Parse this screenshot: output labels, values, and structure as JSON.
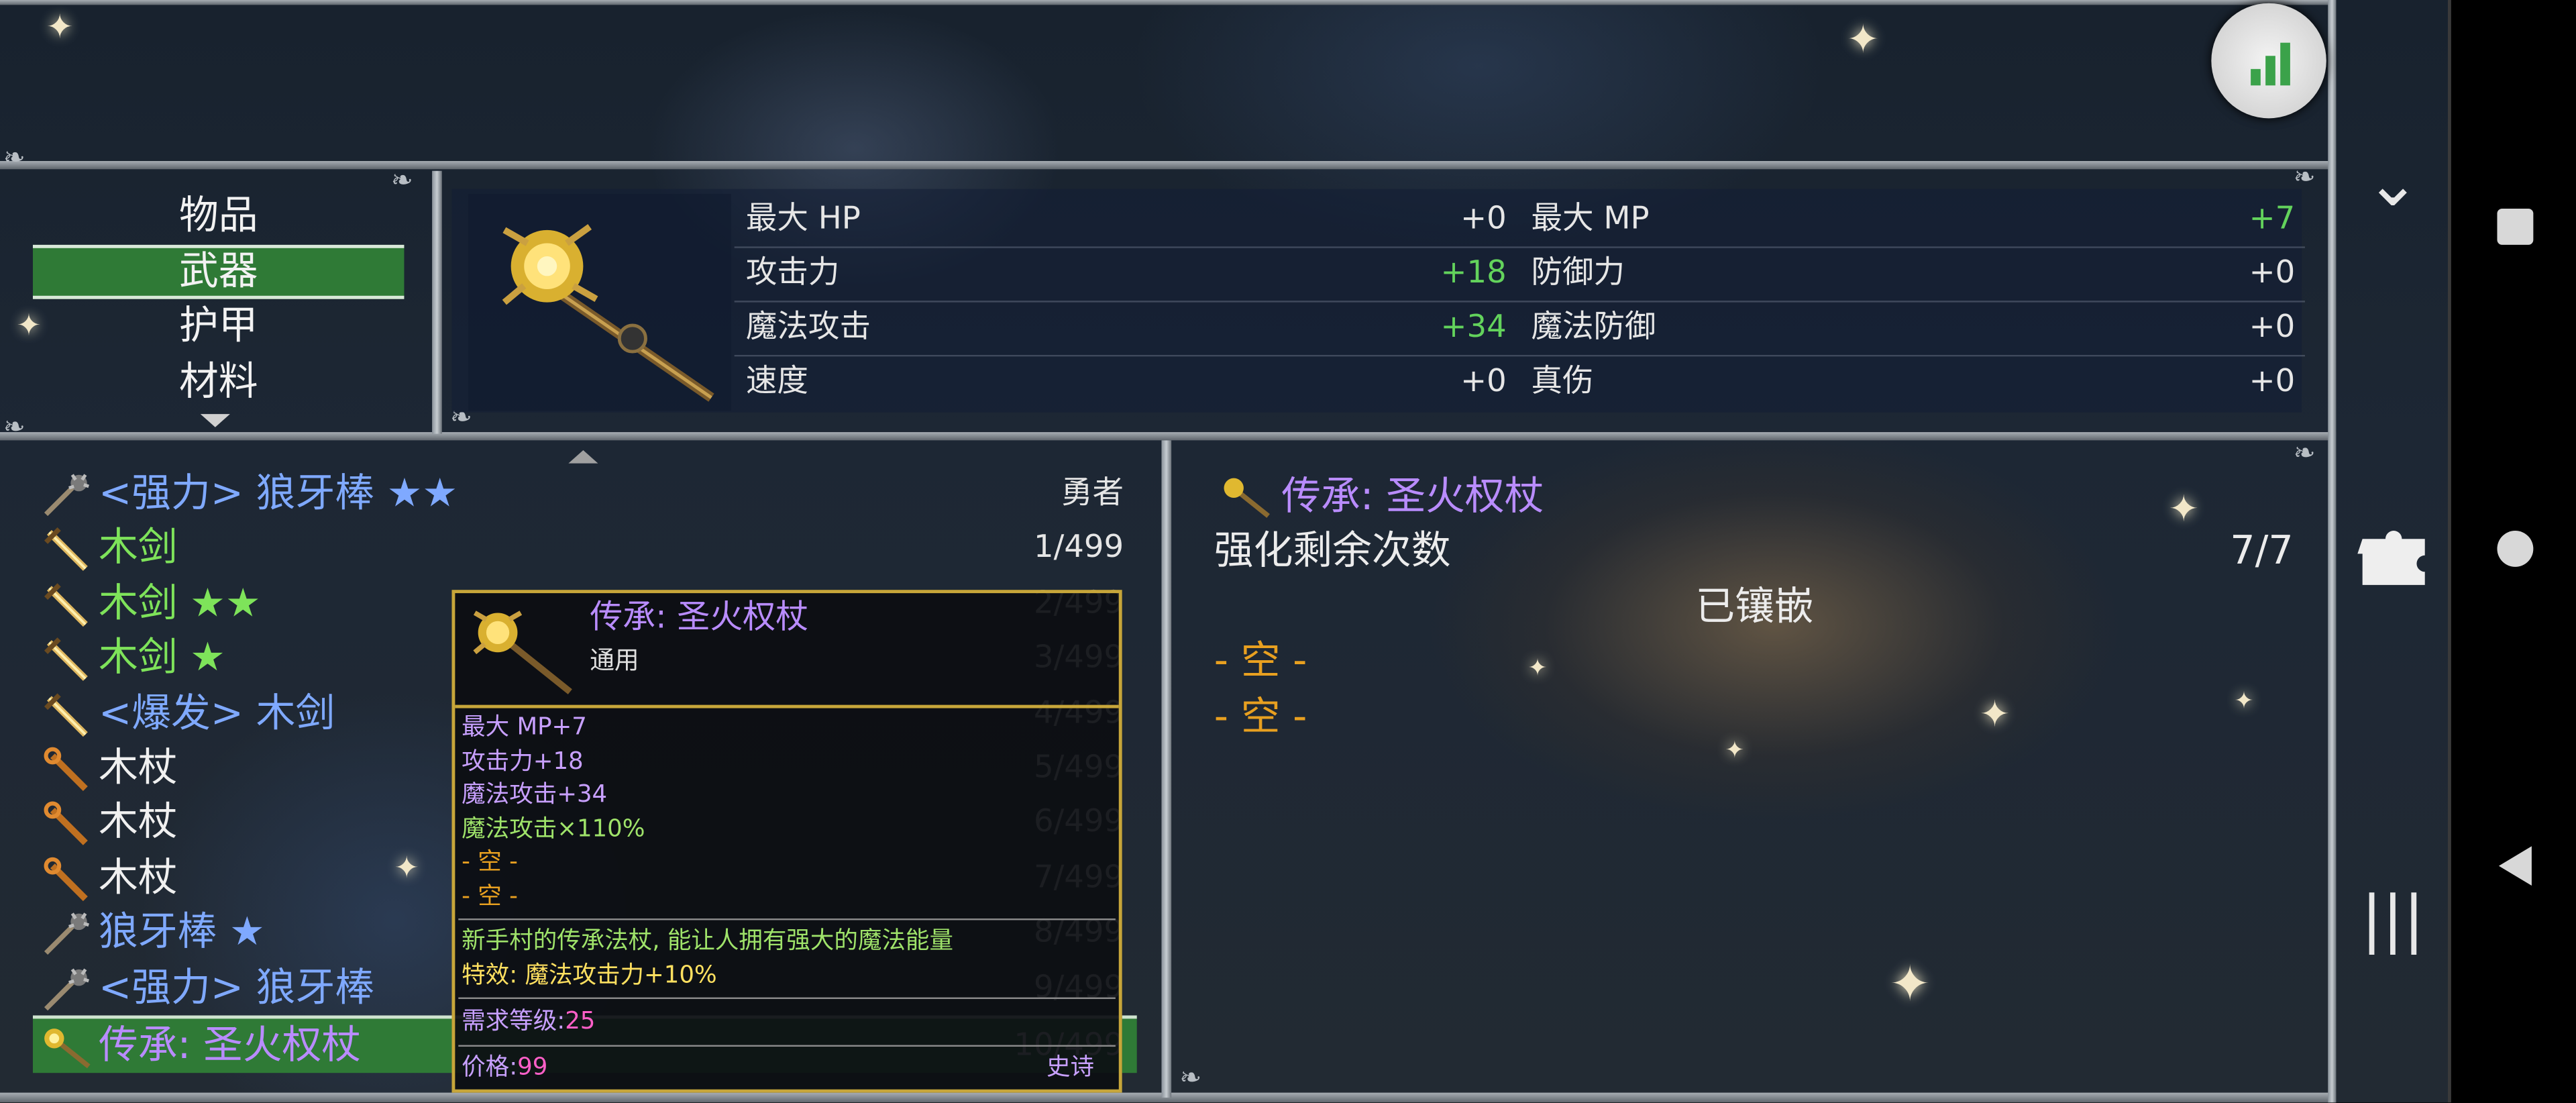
{
  "categories": {
    "items": [
      "物品",
      "武器",
      "护甲",
      "材料"
    ],
    "selected": "武器"
  },
  "stats": {
    "rows": [
      {
        "l_label": "最大 HP",
        "l_value": "+0",
        "r_label": "最大 MP",
        "r_value": "+7"
      },
      {
        "l_label": "攻击力",
        "l_value": "+18",
        "r_label": "防御力",
        "r_value": "+0"
      },
      {
        "l_label": "魔法攻击",
        "l_value": "+34",
        "r_label": "魔法防御",
        "r_value": "+0"
      },
      {
        "l_label": "速度",
        "l_value": "+0",
        "r_label": "真伤",
        "r_value": "+0"
      }
    ]
  },
  "item_list": [
    {
      "name": "<强力> 狼牙棒 ★★",
      "count": "勇者",
      "color": "blue",
      "icon": "mace-icon"
    },
    {
      "name": "木剑",
      "count": "1/499",
      "color": "green",
      "icon": "sword-icon"
    },
    {
      "name": "木剑 ★★",
      "count": "2/499",
      "color": "green",
      "icon": "sword-icon"
    },
    {
      "name": "木剑 ★",
      "count": "3/499",
      "color": "green",
      "icon": "sword-icon"
    },
    {
      "name": "<爆发> 木剑",
      "count": "4/499",
      "color": "blue",
      "icon": "sword-icon"
    },
    {
      "name": "木杖",
      "count": "5/499",
      "color": "white",
      "icon": "staff-icon"
    },
    {
      "name": "木杖",
      "count": "6/499",
      "color": "white",
      "icon": "staff-icon"
    },
    {
      "name": "木杖",
      "count": "7/499",
      "color": "white",
      "icon": "staff-icon"
    },
    {
      "name": "狼牙棒 ★",
      "count": "8/499",
      "color": "blue",
      "icon": "mace-icon"
    },
    {
      "name": "<强力> 狼牙棒",
      "count": "9/499",
      "color": "blue",
      "icon": "mace-icon"
    },
    {
      "name": "传承: 圣火权杖",
      "count": "10/499",
      "color": "purple",
      "icon": "scepter-icon"
    }
  ],
  "tooltip": {
    "title": "传承: 圣火权杖",
    "subtitle": "通用",
    "attrs": [
      "最大 MP+7",
      "攻击力+18",
      "魔法攻击+34",
      "魔法攻击×110%"
    ],
    "slots": [
      "- 空 -",
      "- 空 -"
    ],
    "description": "新手村的传承法杖, 能让人拥有强大的魔法能量",
    "effect": "特效: 魔法攻击力+10%",
    "req_label": "需求等级:",
    "req_value": "25",
    "price_label": "价格:",
    "price_value": "99",
    "rarity": "史诗"
  },
  "detail": {
    "title": "传承: 圣火权杖",
    "refine_label": "强化剩余次数",
    "refine_value": "7/7",
    "inlaid_label": "已镶嵌",
    "slots": [
      "- 空 -",
      "- 空 -"
    ]
  },
  "colors": {
    "selection_green": "#2f7a36",
    "stat_green": "#63d35c",
    "legendary_purple": "#b98cff",
    "rare_blue": "#7fa9ff",
    "uncommon_green": "#7ee35a",
    "slot_orange": "#e8a020",
    "tooltip_border": "#c7a63a"
  }
}
